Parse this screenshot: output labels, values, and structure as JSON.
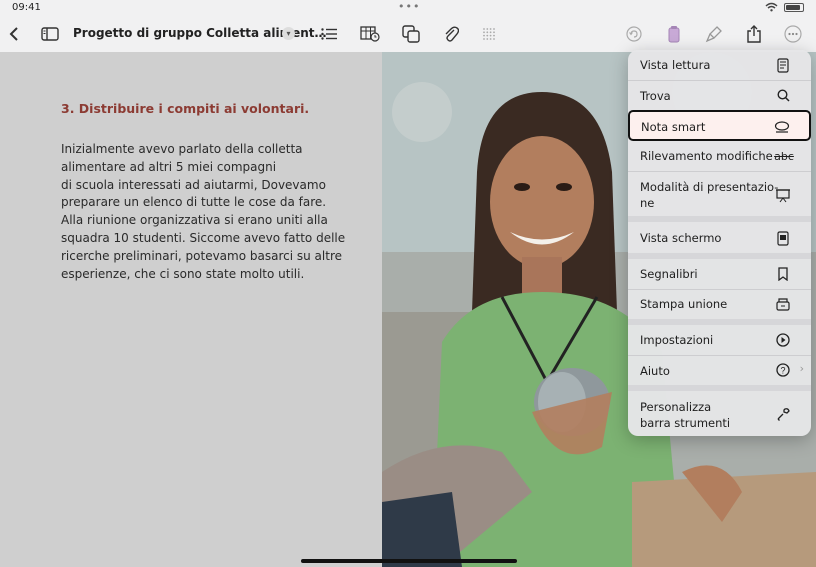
{
  "status": {
    "time": "09:41",
    "wifi": "wifi-icon",
    "battery": "battery-icon"
  },
  "toolbar": {
    "title": "Progetto di gruppo Colletta aliment…",
    "icons": [
      "back-icon",
      "sidebar-icon",
      "chevron-down-icon",
      "list-icon",
      "table-icon",
      "shapes-icon",
      "attachment-icon",
      "grid-icon",
      "undo-icon",
      "notebook-icon",
      "brush-icon",
      "share-icon",
      "more-icon"
    ]
  },
  "document": {
    "heading": "3. Distribuire i compiti ai volontari.",
    "lines": [
      "Inizialmente avevo parlato della colletta",
      "alimentare ad altri 5 miei compagni",
      "di scuola interessati ad aiutarmi, Dovevamo",
      "preparare un elenco di tutte le cose da fare.",
      "Alla riunione organizzativa si erano uniti alla",
      "squadra 10 studenti. Siccome avevo fatto delle",
      "ricerche preliminari, potevamo basarci su altre",
      "esperienze, che ci sono state molto utili."
    ]
  },
  "menu": {
    "items": [
      {
        "label": "Vista lettura",
        "icon": "reading-view-icon"
      },
      {
        "label": "Trova",
        "icon": "search-icon"
      },
      {
        "label": "Nota smart",
        "icon": "smart-note-icon",
        "selected": true
      },
      {
        "label": "Rilevamento modifiche",
        "icon": "abc-strikethrough-icon",
        "icon_text": "abc"
      },
      {
        "label": "Modalità di presentazio-",
        "label2": "ne",
        "icon": "presentation-icon"
      },
      {
        "label": "Vista schermo",
        "icon": "screen-view-icon"
      },
      {
        "label": "Segnalibri",
        "icon": "bookmark-icon"
      },
      {
        "label": "Stampa unione",
        "icon": "mail-merge-icon"
      },
      {
        "label": "Impostazioni",
        "icon": "settings-icon"
      },
      {
        "label": "Aiuto",
        "icon": "help-icon"
      },
      {
        "label": "Personalizza",
        "label2": "barra strumenti",
        "icon": "wrench-icon"
      }
    ]
  }
}
